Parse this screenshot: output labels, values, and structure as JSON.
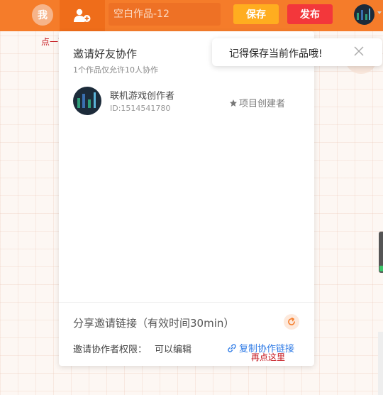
{
  "header": {
    "me_avatar_label": "我",
    "title_placeholder": "空白作品-12",
    "save_label": "保存",
    "publish_label": "发布"
  },
  "hints": {
    "start_hint": "点一下再点开始创作",
    "copy_hint": "再点这里"
  },
  "panel": {
    "title": "邀请好友协作",
    "subtitle": "1个作品仅允许10人协作",
    "members": [
      {
        "name": "联机游戏创作者",
        "id": "ID:1514541780",
        "role": "项目创建者"
      }
    ],
    "share_title": "分享邀请链接（有效时间30min）",
    "permission_label": "邀请协作者权限：",
    "permission_value": "可以编辑",
    "copy_link_label": "复制协作链接"
  },
  "toast": {
    "text": "记得保存当前作品哦!"
  },
  "colors": {
    "topbar": "#f57c2a",
    "save": "#ffad1f",
    "publish": "#f3373b",
    "link": "#2f7be6",
    "hint": "#c5161d"
  },
  "icons": [
    "add-user-icon",
    "star-icon",
    "refresh-icon",
    "link-icon",
    "close-icon"
  ]
}
